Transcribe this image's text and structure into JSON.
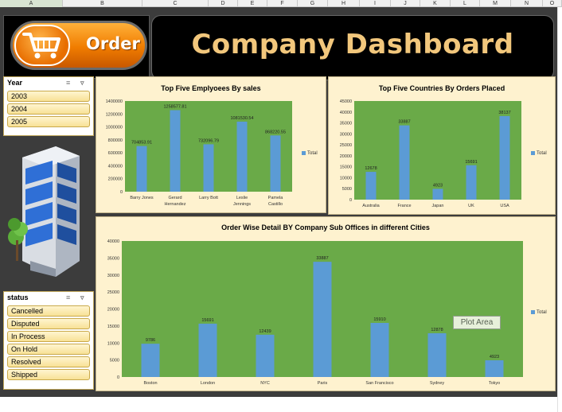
{
  "columns": [
    "A",
    "B",
    "C",
    "D",
    "E",
    "F",
    "G",
    "H",
    "I",
    "J",
    "K",
    "L",
    "M",
    "N",
    "O"
  ],
  "order_button": {
    "label": "Order"
  },
  "title": "Company Dashboard",
  "year_slicer": {
    "header": "Year",
    "items": [
      "2003",
      "2004",
      "2005"
    ]
  },
  "status_slicer": {
    "header": "status",
    "items": [
      "Cancelled",
      "Disputed",
      "In Process",
      "On Hold",
      "Resolved",
      "Shipped"
    ]
  },
  "tooltip": "Plot Area",
  "colors": {
    "plot_area": "#6aaa48",
    "bar": "#5b9bd5",
    "panel_bg": "#fef2cf",
    "title": "#f2c77c",
    "order_orange": "#f07c00"
  },
  "chart_data": [
    {
      "type": "bar",
      "title": "Top Five Emplyoees By sales",
      "categories": [
        "Barry Jones",
        "Gerard Hernandez",
        "Larry Bott",
        "Leslie Jennings",
        "Pamela Castillo"
      ],
      "category_lines": [
        [
          "Barry Jones"
        ],
        [
          "Gerard",
          "Hernandez"
        ],
        [
          "Larry Bott"
        ],
        [
          "Leslie",
          "Jennings"
        ],
        [
          "Pamela",
          "Castillo"
        ]
      ],
      "values": [
        704853.91,
        1258577.81,
        732096.79,
        1081530.54,
        868220.55
      ],
      "value_labels": [
        "704853.91",
        "1258577.81",
        "732096.79",
        "1081530.54",
        "868220.55"
      ],
      "yticks": [
        "0",
        "200000",
        "400000",
        "600000",
        "800000",
        "1000000",
        "1200000",
        "1400000"
      ],
      "ylim": [
        0,
        1400000
      ],
      "legend": "Total",
      "legend_position": "right"
    },
    {
      "type": "bar",
      "title": "Top Five Countries By Orders Placed",
      "categories": [
        "Australia",
        "France",
        "Japan",
        "UK",
        "USA"
      ],
      "category_lines": [
        [
          "Australia"
        ],
        [
          "France"
        ],
        [
          "Japan"
        ],
        [
          "UK"
        ],
        [
          "USA"
        ]
      ],
      "values": [
        12678,
        33887,
        4923,
        15691,
        38137
      ],
      "value_labels": [
        "12678",
        "33887",
        "4923",
        "15691",
        "38137"
      ],
      "yticks": [
        "0",
        "5000",
        "10000",
        "15000",
        "20000",
        "25000",
        "30000",
        "35000",
        "40000",
        "45000"
      ],
      "ylim": [
        0,
        45000
      ],
      "legend": "Total",
      "legend_position": "right"
    },
    {
      "type": "bar",
      "title": "Order Wise Detail BY Company Sub Offices in different Cities",
      "categories": [
        "Boston",
        "London",
        "NYC",
        "Paris",
        "San Francisco",
        "Sydney",
        "Tokyo"
      ],
      "category_lines": [
        [
          "Boston"
        ],
        [
          "London"
        ],
        [
          "NYC"
        ],
        [
          "Paris"
        ],
        [
          "San Francisco"
        ],
        [
          "Sydney"
        ],
        [
          "Tokyo"
        ]
      ],
      "values": [
        9786,
        15691,
        12439,
        33887,
        15910,
        12878,
        4923
      ],
      "value_labels": [
        "9786",
        "15691",
        "12439",
        "33887",
        "15910",
        "12878",
        "4923"
      ],
      "yticks": [
        "0",
        "5000",
        "10000",
        "15000",
        "20000",
        "25000",
        "30000",
        "35000",
        "40000"
      ],
      "ylim": [
        0,
        40000
      ],
      "legend": "Total",
      "legend_position": "right"
    }
  ]
}
